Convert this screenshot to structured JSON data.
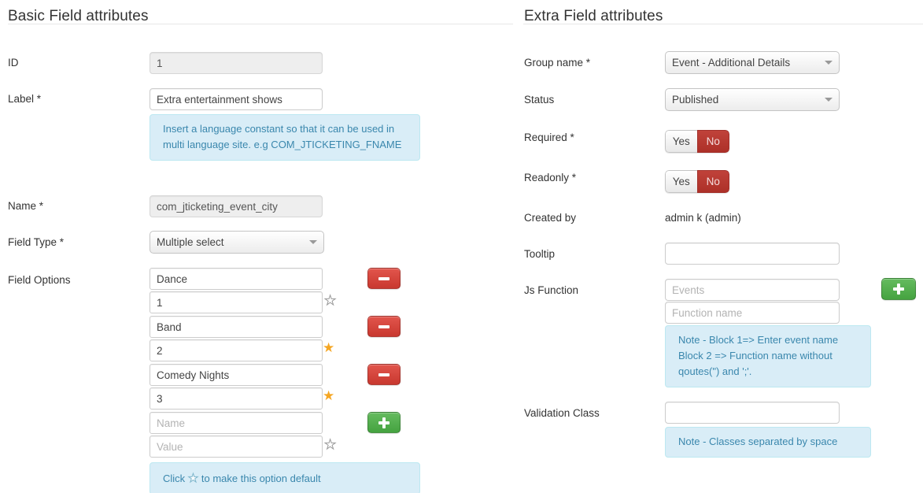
{
  "left": {
    "heading": "Basic Field attributes",
    "fields": {
      "id_label": "ID",
      "id_value": "1",
      "label_label": "Label *",
      "label_value": "Extra entertainment shows",
      "label_note": "Insert a language constant so that it can be used in multi language site. e.g COM_JTICKETING_FNAME",
      "name_label": "Name *",
      "name_value": "com_jticketing_event_city",
      "field_type_label": "Field Type *",
      "field_type_value": "Multiple select",
      "field_type_options": [
        "Multiple select"
      ],
      "field_options_label": "Field Options"
    },
    "options": [
      {
        "name": "Dance",
        "value": "1",
        "default": false,
        "action": "remove"
      },
      {
        "name": "Band",
        "value": "2",
        "default": true,
        "action": "remove"
      },
      {
        "name": "Comedy Nights",
        "value": "3",
        "default": true,
        "action": "remove"
      },
      {
        "name": "",
        "value": "",
        "default": false,
        "action": "add",
        "name_placeholder": "Name",
        "value_placeholder": "Value"
      }
    ],
    "options_note_before": "Click",
    "options_note_star": "☆",
    "options_note_after": "to make this option default"
  },
  "right": {
    "heading": "Extra Field attributes",
    "group_name_label": "Group name *",
    "group_name_value": "Event - Additional Details",
    "group_name_options": [
      "Event - Additional Details"
    ],
    "status_label": "Status",
    "status_value": "Published",
    "status_options": [
      "Published"
    ],
    "required_label": "Required *",
    "required_yes": "Yes",
    "required_no": "No",
    "required_selected": "No",
    "readonly_label": "Readonly *",
    "readonly_yes": "Yes",
    "readonly_no": "No",
    "readonly_selected": "No",
    "created_by_label": "Created by",
    "created_by_value": "admin k (admin)",
    "tooltip_label": "Tooltip",
    "tooltip_value": "",
    "js_function_label": "Js Function",
    "js_event_placeholder": "Events",
    "js_event_value": "",
    "js_function_placeholder": "Function name",
    "js_function_value": "",
    "js_note_line1": "Note - Block 1=> Enter event name",
    "js_note_line2": "Block 2 => Function name without",
    "js_note_line3": "qoutes(\") and ';'.",
    "validation_label": "Validation Class",
    "validation_value": "",
    "validation_note": "Note - Classes separated by space"
  },
  "colors": {
    "note_bg": "#d9edf7",
    "note_text": "#3a87ad",
    "danger": "#c8382f",
    "success": "#45a340",
    "star_on": "#f5a623"
  }
}
